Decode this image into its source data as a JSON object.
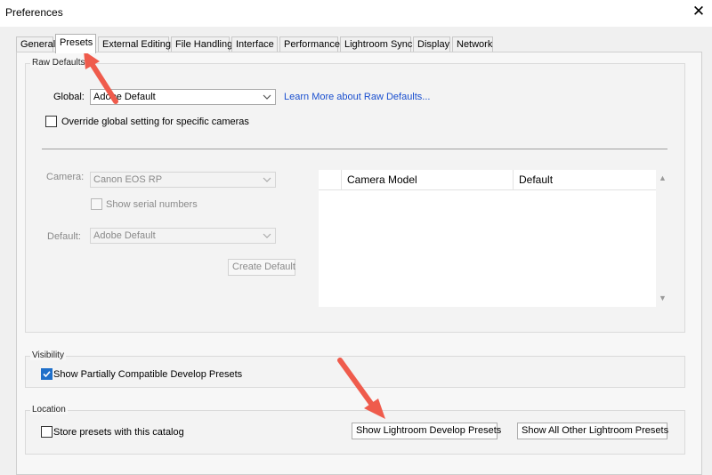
{
  "window": {
    "title": "Preferences"
  },
  "tabs": [
    {
      "label": "General",
      "active": false
    },
    {
      "label": "Presets",
      "active": true
    },
    {
      "label": "External Editing",
      "active": false
    },
    {
      "label": "File Handling",
      "active": false
    },
    {
      "label": "Interface",
      "active": false
    },
    {
      "label": "Performance",
      "active": false
    },
    {
      "label": "Lightroom Sync",
      "active": false
    },
    {
      "label": "Display",
      "active": false
    },
    {
      "label": "Network",
      "active": false
    }
  ],
  "raw_defaults": {
    "group_label": "Raw Defaults",
    "global_label": "Global:",
    "global_value": "Adobe Default",
    "learn_more_link": "Learn More about Raw Defaults...",
    "override_label": "Override global setting for specific cameras",
    "camera_label": "Camera:",
    "camera_value": "Canon EOS RP",
    "serial_label": "Show serial numbers",
    "default_label": "Default:",
    "default_value": "Adobe Default",
    "create_default_button": "Create Default",
    "table": {
      "columns": [
        "Camera Model",
        "Default"
      ]
    }
  },
  "visibility": {
    "group_label": "Visibility",
    "show_partial_label": "Show Partially Compatible Develop Presets",
    "show_partial_checked": true
  },
  "location": {
    "group_label": "Location",
    "store_label": "Store presets with this catalog",
    "store_checked": false,
    "show_develop_button": "Show Lightroom Develop Presets",
    "show_other_button": "Show All Other Lightroom Presets"
  },
  "colors": {
    "accent": "#1f6fc9",
    "link": "#1a4fcf",
    "annotation_arrow": "#ef5b4c"
  }
}
